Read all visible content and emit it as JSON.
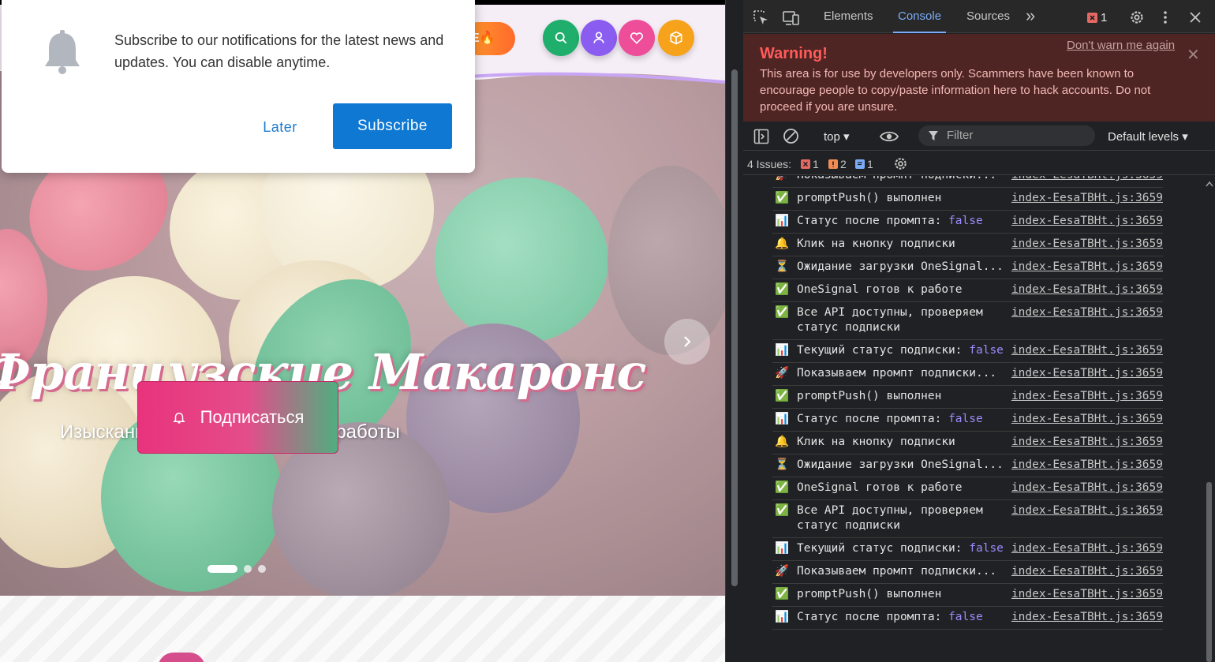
{
  "site": {
    "promo_text": "E",
    "promo_emoji": "🔥",
    "header_buttons": [
      {
        "name": "search-icon",
        "color": "#1fae6c"
      },
      {
        "name": "user-icon",
        "color": "#8a5cf0"
      },
      {
        "name": "heart-icon",
        "color": "#ee4d9a"
      },
      {
        "name": "box-icon",
        "color": "#f6a21b"
      }
    ],
    "hero": {
      "title": "Французские Макаронс",
      "subtitle": "Изысканные пирожные ручной работы",
      "subscribe_label": "Подписаться",
      "slide_count": 3,
      "active_slide": 1
    }
  },
  "notification_prompt": {
    "message": "Subscribe to our notifications for the latest news and updates. You can disable anytime.",
    "later_label": "Later",
    "subscribe_label": "Subscribe"
  },
  "devtools": {
    "tabs": [
      "Elements",
      "Console",
      "Sources"
    ],
    "active_tab": "Console",
    "more_tabs_symbol": "»",
    "error_badge_count": "1",
    "warning": {
      "title": "Warning!",
      "text": "This area is for use by developers only. Scammers have been known to encourage people to copy/paste information here to hack accounts. Do not proceed if you are unsure.",
      "dont_warn": "Don't warn me again"
    },
    "toolbar": {
      "context": "top",
      "filter_placeholder": "Filter",
      "levels": "Default levels"
    },
    "issues": {
      "label": "4 Issues:",
      "errors": "1",
      "warnings": "2",
      "info": "1"
    },
    "log_partial_first": "Показываем промпт подписки...",
    "log_source": "index-EesaTBHt.js:3659",
    "logs": [
      {
        "icon": "✅",
        "text": "promptPush() выполнен",
        "value": ""
      },
      {
        "icon": "📊",
        "text": "Статус после промпта:",
        "value": "false"
      },
      {
        "icon": "🔔",
        "text": "Клик на кнопку подписки",
        "value": ""
      },
      {
        "icon": "⏳",
        "text": "Ожидание загрузки OneSignal...",
        "value": ""
      },
      {
        "icon": "✅",
        "text": "OneSignal готов к работе",
        "value": ""
      },
      {
        "icon": "✅",
        "text": "Все API доступны, проверяем статус подписки",
        "value": ""
      },
      {
        "icon": "📊",
        "text": "Текущий статус подписки:",
        "value": "false"
      },
      {
        "icon": "🚀",
        "text": "Показываем промпт подписки...",
        "value": ""
      },
      {
        "icon": "✅",
        "text": "promptPush() выполнен",
        "value": ""
      },
      {
        "icon": "📊",
        "text": "Статус после промпта:",
        "value": "false"
      },
      {
        "icon": "🔔",
        "text": "Клик на кнопку подписки",
        "value": ""
      },
      {
        "icon": "⏳",
        "text": "Ожидание загрузки OneSignal...",
        "value": ""
      },
      {
        "icon": "✅",
        "text": "OneSignal готов к работе",
        "value": ""
      },
      {
        "icon": "✅",
        "text": "Все API доступны, проверяем статус подписки",
        "value": ""
      },
      {
        "icon": "📊",
        "text": "Текущий статус подписки:",
        "value": "false"
      },
      {
        "icon": "🚀",
        "text": "Показываем промпт подписки...",
        "value": ""
      },
      {
        "icon": "✅",
        "text": "promptPush() выполнен",
        "value": ""
      },
      {
        "icon": "📊",
        "text": "Статус после промпта:",
        "value": "false"
      }
    ]
  }
}
